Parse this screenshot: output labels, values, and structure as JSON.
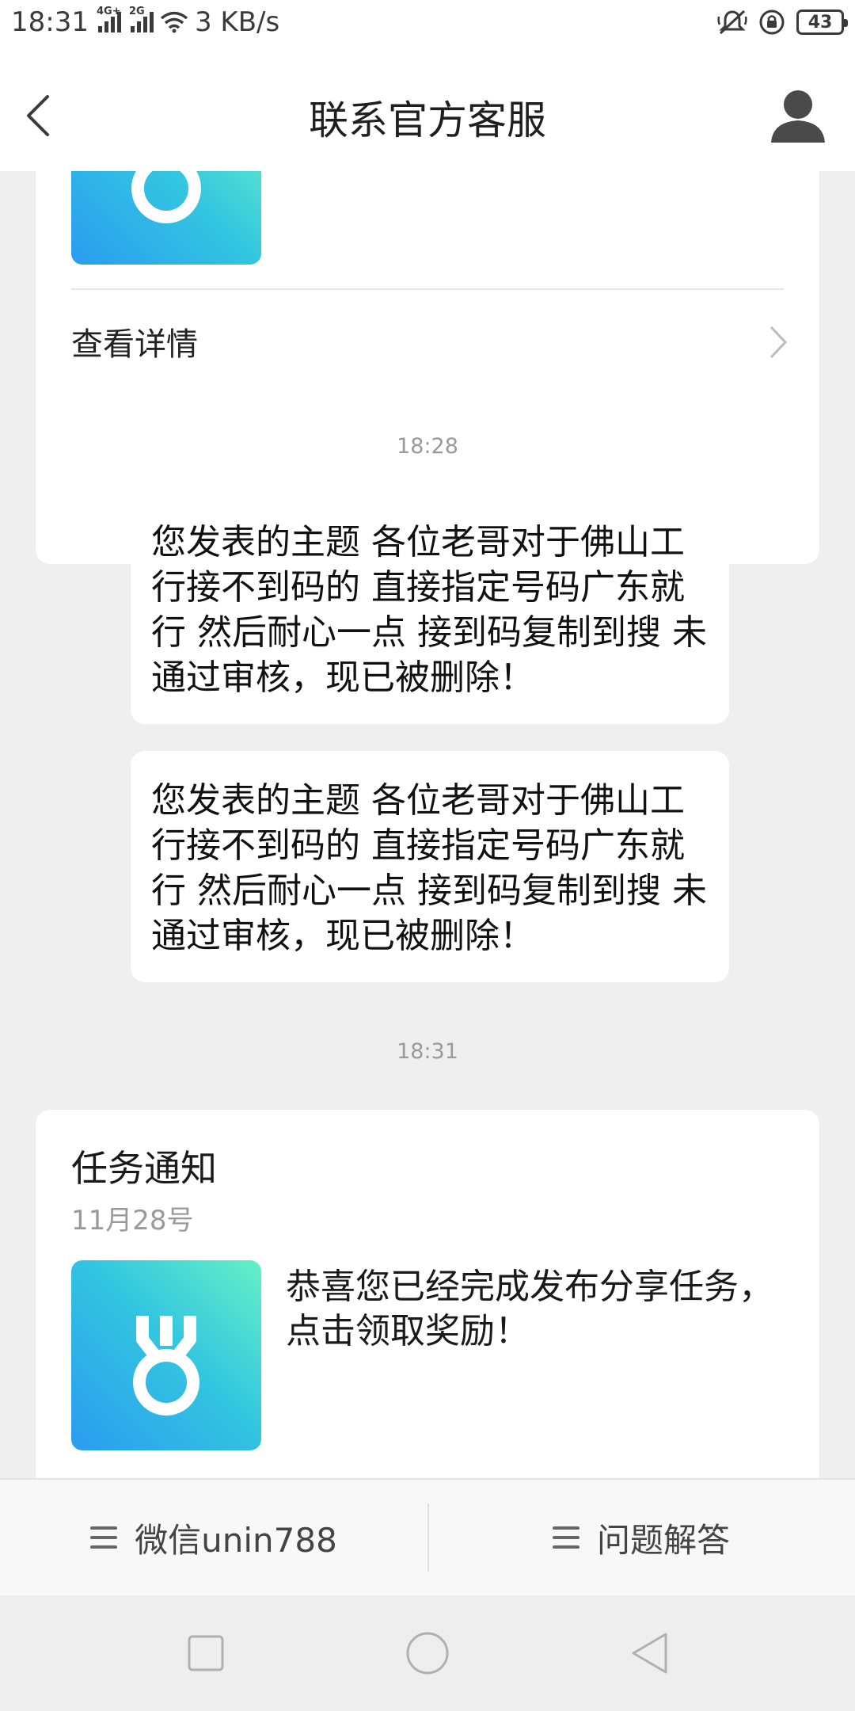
{
  "status_bar": {
    "time": "18:31",
    "network_1": "4G+",
    "network_2": "2G",
    "speed": "3 KB/s",
    "battery": "43"
  },
  "header": {
    "title": "联系官方客服"
  },
  "cards": {
    "top": {
      "details_label": "查看详情"
    },
    "notice": {
      "title": "任务通知",
      "date": "11月28号",
      "text": "恭喜您已经完成发布分享任务，点击领取奖励！"
    }
  },
  "timestamps": [
    "18:28",
    "18:31"
  ],
  "messages": [
    "您发表的主题 各位老哥对于佛山工行接不到码的 直接指定号码广东就行 然后耐心一点 接到码复制到搜 未通过审核，现已被删除！",
    "您发表的主题 各位老哥对于佛山工行接不到码的 直接指定号码广东就行 然后耐心一点 接到码复制到搜 未通过审核，现已被删除！"
  ],
  "bottom_menu": {
    "items": [
      {
        "label": "微信unin788",
        "icon": "menu-icon"
      },
      {
        "label": "问题解答",
        "icon": "menu-icon"
      }
    ]
  },
  "nav_bar": {
    "icons": [
      "recent-apps-icon",
      "home-icon",
      "back-triangle-icon"
    ]
  },
  "colors": {
    "background": "#efefef",
    "card": "#ffffff",
    "medal_gradient_start": "#66f0c6",
    "medal_gradient_end": "#2a9cf0",
    "muted_text": "#9a9a9a"
  }
}
